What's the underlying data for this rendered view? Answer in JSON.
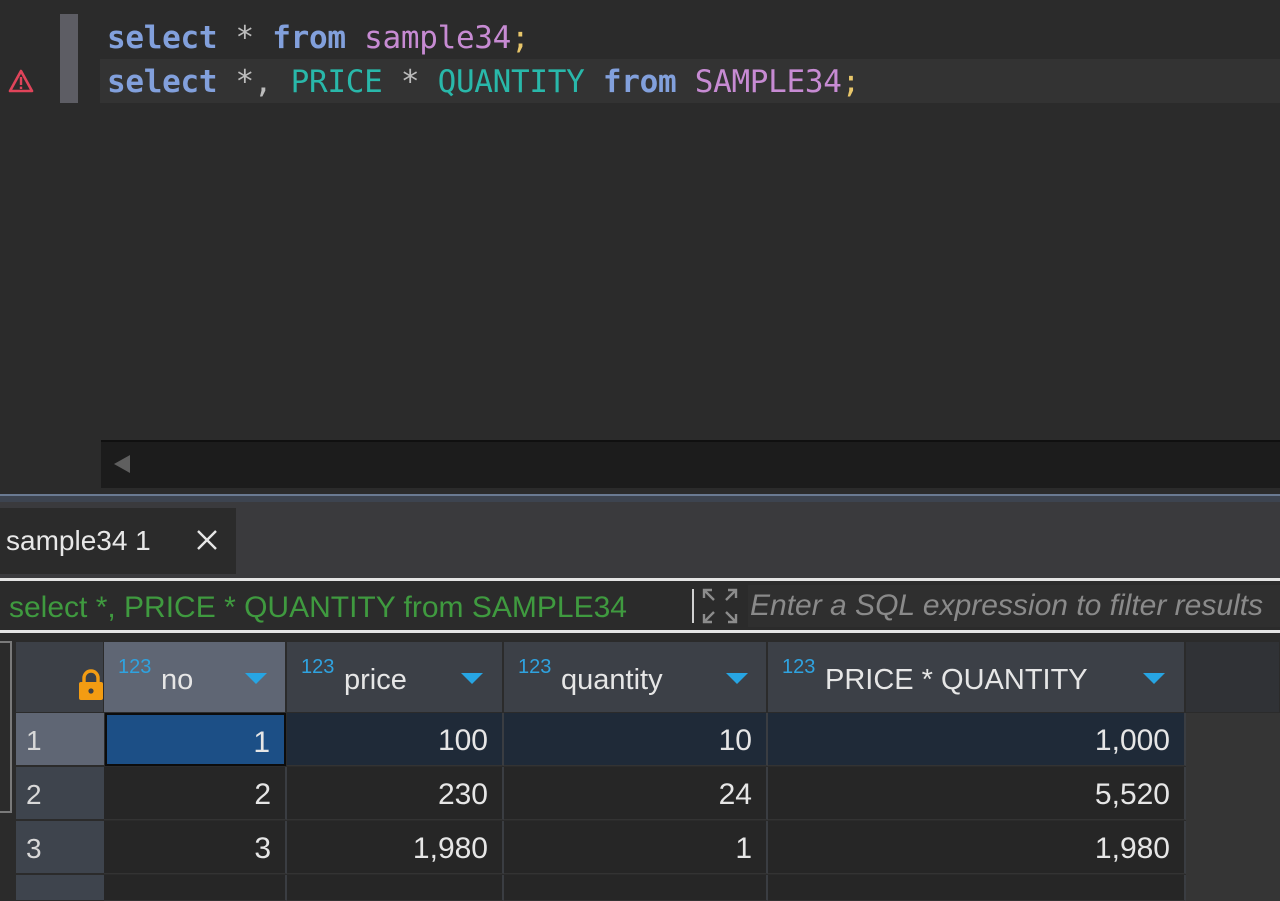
{
  "editor": {
    "line1": {
      "kw1": "select",
      "op1": " * ",
      "kw2": "from",
      "sp": " ",
      "table": "sample34",
      "semi": ";"
    },
    "line2": {
      "kw1": "select",
      "op1": " *, ",
      "col1": "PRICE",
      "op2": " * ",
      "col2": "QUANTITY",
      "sp1": " ",
      "kw2": "from",
      "sp2": " ",
      "table": "SAMPLE34",
      "semi": ";"
    }
  },
  "results_tab": {
    "label": "sample34 1"
  },
  "filter": {
    "query": "select *, PRICE * QUANTITY from SAMPLE34",
    "placeholder": "Enter a SQL expression to filter results"
  },
  "grid": {
    "type_badge": "123",
    "columns": [
      "no",
      "price",
      "quantity",
      "PRICE * QUANTITY"
    ],
    "rows": [
      {
        "rownum": "1",
        "cells": [
          "1",
          "100",
          "10",
          "1,000"
        ]
      },
      {
        "rownum": "2",
        "cells": [
          "2",
          "230",
          "24",
          "5,520"
        ]
      },
      {
        "rownum": "3",
        "cells": [
          "3",
          "1,980",
          "1",
          "1,980"
        ]
      }
    ]
  },
  "colors": {
    "keyword": "#82a0dc",
    "table": "#c78bd3",
    "column": "#29b8aa",
    "semicolon": "#e8c66a",
    "filter_query": "#3f9a3f",
    "type_badge": "#2fa3e0",
    "lock": "#f39c12",
    "warning": "#e0445a"
  }
}
